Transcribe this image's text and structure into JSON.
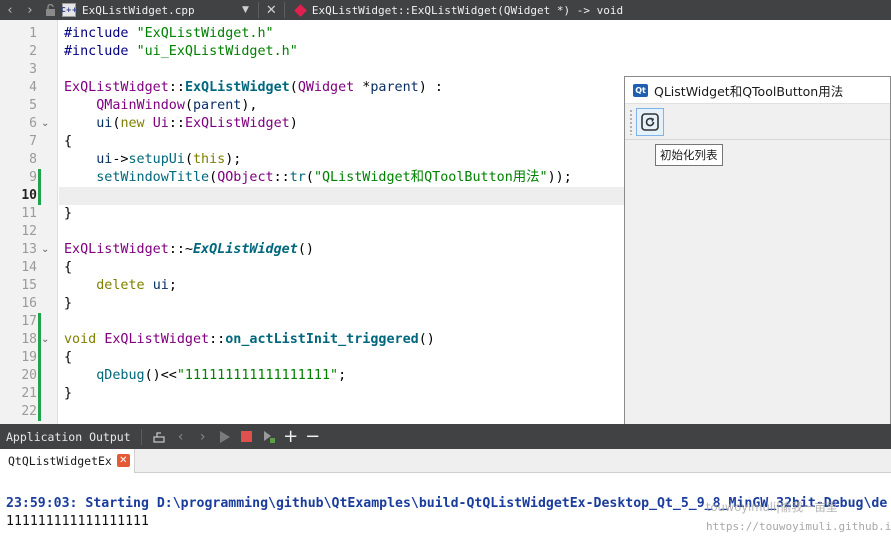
{
  "editor_toolbar": {
    "back_icon": "chevron-left-icon",
    "forward_icon": "chevron-right-icon",
    "lock_icon": "lock-icon",
    "file_icon_text": "C++",
    "file_name": "ExQListWidget.cpp",
    "dropdown_icon": "triangle-down-icon",
    "close_icon": "close-icon",
    "symbol": "ExQListWidget::ExQListWidget(QWidget *) -> void"
  },
  "current_line": 10,
  "lines": [
    {
      "n": "1",
      "fold": false,
      "mark": false,
      "tokens": [
        {
          "c": "t-pp",
          "t": "#include "
        },
        {
          "c": "t-str",
          "t": "\"ExQListWidget.h\""
        }
      ]
    },
    {
      "n": "2",
      "fold": false,
      "mark": false,
      "tokens": [
        {
          "c": "t-pp",
          "t": "#include "
        },
        {
          "c": "t-str",
          "t": "\"ui_ExQListWidget.h\""
        }
      ]
    },
    {
      "n": "3",
      "fold": false,
      "mark": false,
      "tokens": []
    },
    {
      "n": "4",
      "fold": false,
      "mark": false,
      "tokens": [
        {
          "c": "t-cls",
          "t": "ExQListWidget"
        },
        {
          "c": "t-plain",
          "t": "::"
        },
        {
          "c": "t-fnb",
          "t": "ExQListWidget"
        },
        {
          "c": "t-plain",
          "t": "("
        },
        {
          "c": "t-cls",
          "t": "QWidget"
        },
        {
          "c": "t-plain",
          "t": " *"
        },
        {
          "c": "t-var",
          "t": "parent"
        },
        {
          "c": "t-plain",
          "t": ") :"
        }
      ]
    },
    {
      "n": "5",
      "fold": false,
      "mark": false,
      "tokens": [
        {
          "c": "t-plain",
          "t": "    "
        },
        {
          "c": "t-cls",
          "t": "QMainWindow"
        },
        {
          "c": "t-plain",
          "t": "("
        },
        {
          "c": "t-var",
          "t": "parent"
        },
        {
          "c": "t-plain",
          "t": "),"
        }
      ]
    },
    {
      "n": "6",
      "fold": true,
      "mark": false,
      "tokens": [
        {
          "c": "t-plain",
          "t": "    "
        },
        {
          "c": "t-var",
          "t": "ui"
        },
        {
          "c": "t-plain",
          "t": "("
        },
        {
          "c": "t-kw",
          "t": "new"
        },
        {
          "c": "t-plain",
          "t": " "
        },
        {
          "c": "t-cls",
          "t": "Ui"
        },
        {
          "c": "t-plain",
          "t": "::"
        },
        {
          "c": "t-cls",
          "t": "ExQListWidget"
        },
        {
          "c": "t-plain",
          "t": ")"
        }
      ]
    },
    {
      "n": "7",
      "fold": false,
      "mark": false,
      "tokens": [
        {
          "c": "t-plain",
          "t": "{"
        }
      ]
    },
    {
      "n": "8",
      "fold": false,
      "mark": false,
      "tokens": [
        {
          "c": "t-plain",
          "t": "    "
        },
        {
          "c": "t-var",
          "t": "ui"
        },
        {
          "c": "t-plain",
          "t": "->"
        },
        {
          "c": "t-meth",
          "t": "setupUi"
        },
        {
          "c": "t-plain",
          "t": "("
        },
        {
          "c": "t-kw",
          "t": "this"
        },
        {
          "c": "t-plain",
          "t": ");"
        }
      ]
    },
    {
      "n": "9",
      "fold": false,
      "mark": true,
      "tokens": [
        {
          "c": "t-plain",
          "t": "    "
        },
        {
          "c": "t-fn",
          "t": "setWindowTitle"
        },
        {
          "c": "t-plain",
          "t": "("
        },
        {
          "c": "t-cls",
          "t": "QObject"
        },
        {
          "c": "t-plain",
          "t": "::"
        },
        {
          "c": "t-fn",
          "t": "tr"
        },
        {
          "c": "t-plain",
          "t": "("
        },
        {
          "c": "t-str",
          "t": "\"QListWidget和QToolButton用法\""
        },
        {
          "c": "t-plain",
          "t": "));"
        }
      ]
    },
    {
      "n": "10",
      "fold": false,
      "mark": true,
      "tokens": []
    },
    {
      "n": "11",
      "fold": false,
      "mark": false,
      "tokens": [
        {
          "c": "t-plain",
          "t": "}"
        }
      ]
    },
    {
      "n": "12",
      "fold": false,
      "mark": false,
      "tokens": []
    },
    {
      "n": "13",
      "fold": true,
      "mark": false,
      "tokens": [
        {
          "c": "t-cls",
          "t": "ExQListWidget"
        },
        {
          "c": "t-plain",
          "t": "::~"
        },
        {
          "c": "t-fnbi",
          "t": "ExQListWidget"
        },
        {
          "c": "t-plain",
          "t": "()"
        }
      ]
    },
    {
      "n": "14",
      "fold": false,
      "mark": false,
      "tokens": [
        {
          "c": "t-plain",
          "t": "{"
        }
      ]
    },
    {
      "n": "15",
      "fold": false,
      "mark": false,
      "tokens": [
        {
          "c": "t-plain",
          "t": "    "
        },
        {
          "c": "t-kw",
          "t": "delete"
        },
        {
          "c": "t-plain",
          "t": " "
        },
        {
          "c": "t-var",
          "t": "ui"
        },
        {
          "c": "t-plain",
          "t": ";"
        }
      ]
    },
    {
      "n": "16",
      "fold": false,
      "mark": false,
      "tokens": [
        {
          "c": "t-plain",
          "t": "}"
        }
      ]
    },
    {
      "n": "17",
      "fold": false,
      "mark": true,
      "tokens": []
    },
    {
      "n": "18",
      "fold": true,
      "mark": true,
      "tokens": [
        {
          "c": "t-kw",
          "t": "void"
        },
        {
          "c": "t-plain",
          "t": " "
        },
        {
          "c": "t-cls",
          "t": "ExQListWidget"
        },
        {
          "c": "t-plain",
          "t": "::"
        },
        {
          "c": "t-fnb",
          "t": "on_actListInit_triggered"
        },
        {
          "c": "t-plain",
          "t": "()"
        }
      ]
    },
    {
      "n": "19",
      "fold": false,
      "mark": true,
      "tokens": [
        {
          "c": "t-plain",
          "t": "{"
        }
      ]
    },
    {
      "n": "20",
      "fold": false,
      "mark": true,
      "tokens": [
        {
          "c": "t-plain",
          "t": "    "
        },
        {
          "c": "t-fn",
          "t": "qDebug"
        },
        {
          "c": "t-plain",
          "t": "()<<"
        },
        {
          "c": "t-str",
          "t": "\"111111111111111111\""
        },
        {
          "c": "t-plain",
          "t": ";"
        }
      ]
    },
    {
      "n": "21",
      "fold": false,
      "mark": true,
      "tokens": [
        {
          "c": "t-plain",
          "t": "}"
        }
      ]
    },
    {
      "n": "22",
      "fold": false,
      "mark": true,
      "tokens": []
    }
  ],
  "app_window": {
    "logo_icon": "qt-logo-icon",
    "title": "QListWidget和QToolButton用法",
    "tool_icon": "list-init-icon",
    "tooltip": "初始化列表"
  },
  "output_bar": {
    "title": "Application Output",
    "icons": [
      "attach-icon",
      "prev-icon",
      "next-icon",
      "run-icon",
      "stop-icon",
      "attach-debugger-icon",
      "plus-icon",
      "minus-icon"
    ]
  },
  "output": {
    "tab_label": "QtQListWidgetEx",
    "start_line": "23:59:03: Starting D:\\programming\\github\\QtExamples\\build-QtQListWidgetEx-Desktop_Qt_5_9_8_MinGW_32bit-Debug\\de",
    "value_line": "111111111111111111",
    "watermark_cn": "touwoyimuli|偷我一亩里",
    "watermark_url": "https://touwoyimuli.github.io"
  }
}
